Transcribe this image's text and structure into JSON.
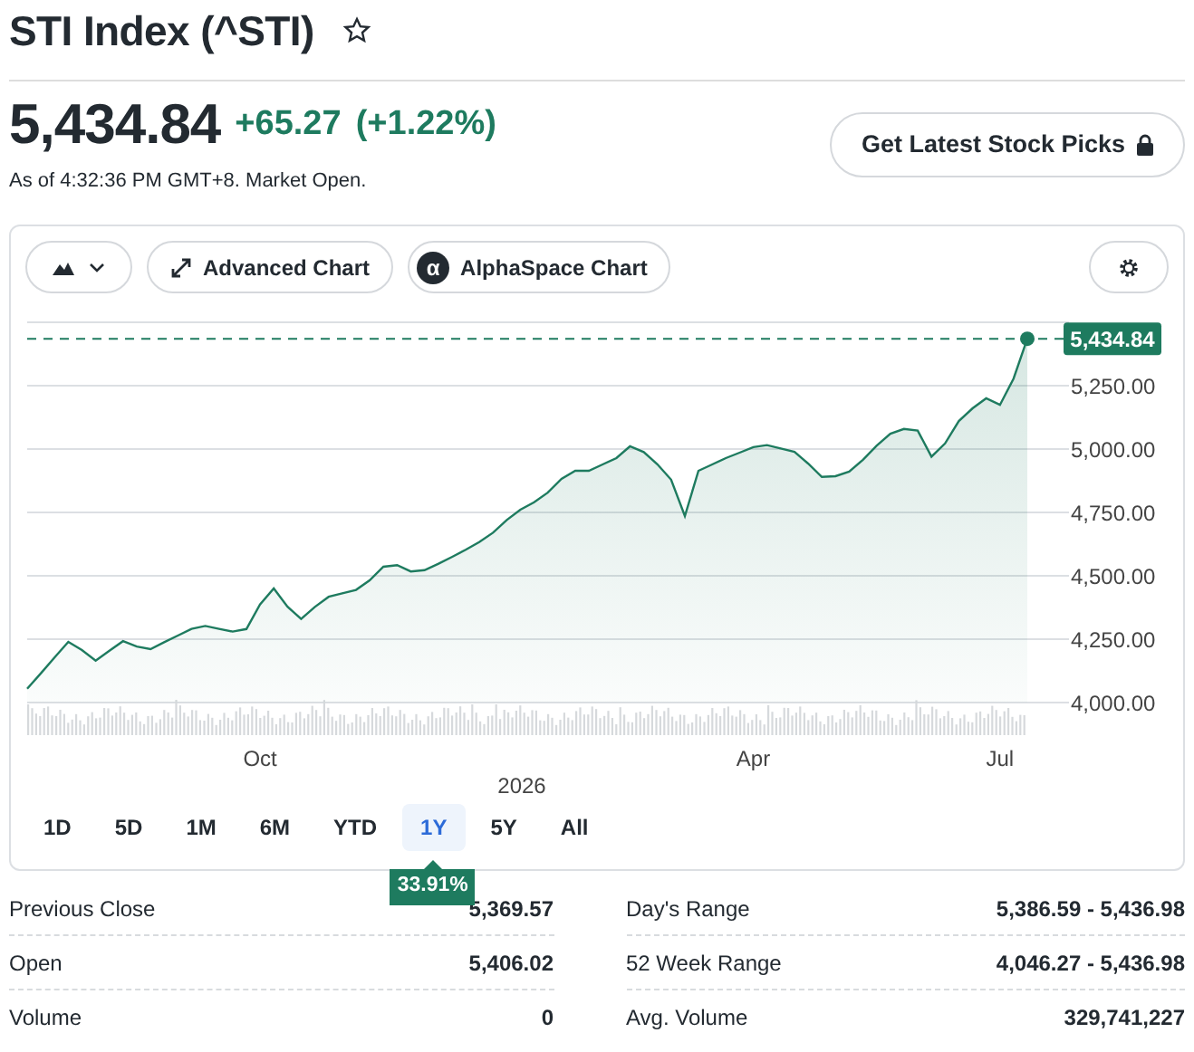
{
  "header": {
    "title": "STI Index (^STI)",
    "watchlist_starred": false
  },
  "quote": {
    "price": "5,434.84",
    "change": "+65.27",
    "change_percent": "(+1.22%)",
    "timestamp": "As of 4:32:36 PM GMT+8. Market Open.",
    "picks_button": "Get Latest Stock Picks"
  },
  "chart_toolbar": {
    "buttons": [
      {
        "kind": "type"
      },
      {
        "kind": "advanced",
        "label": "Advanced Chart"
      },
      {
        "kind": "alpha",
        "label": "AlphaSpace Chart",
        "icon_char": "α"
      }
    ]
  },
  "chart": {
    "last_price_tag": "5,434.84",
    "x_caption": "2026",
    "chart_data": {
      "type": "area",
      "categories": [
        null,
        null,
        null,
        null,
        null,
        null,
        null,
        null,
        null,
        null,
        null,
        null,
        null,
        null,
        null,
        null,
        null,
        "Oct",
        null,
        null,
        null,
        null,
        null,
        null,
        null,
        null,
        null,
        null,
        null,
        null,
        null,
        null,
        null,
        null,
        null,
        null,
        null,
        null,
        null,
        null,
        null,
        null,
        null,
        null,
        null,
        null,
        null,
        null,
        null,
        null,
        null,
        null,
        null,
        "Apr",
        null,
        null,
        null,
        null,
        null,
        null,
        null,
        null,
        null,
        null,
        null,
        null,
        null,
        null,
        null,
        null,
        null,
        "Jul",
        null,
        null
      ],
      "series": [
        {
          "color": "#1e7b5f",
          "values": [
            4054,
            4116,
            4178,
            4239,
            4207,
            4165,
            4204,
            4242,
            4221,
            4211,
            4238,
            4264,
            4291,
            4302,
            4291,
            4280,
            4290,
            4387,
            4450,
            4378,
            4330,
            4377,
            4417,
            4431,
            4444,
            4482,
            4536,
            4542,
            4517,
            4522,
            4547,
            4574,
            4603,
            4633,
            4670,
            4720,
            4761,
            4790,
            4828,
            4882,
            4914,
            4914,
            4939,
            4964,
            5011,
            4988,
            4940,
            4879,
            4736,
            4914,
            4939,
            4964,
            4986,
            5008,
            5016,
            5002,
            4989,
            4943,
            4890,
            4893,
            4911,
            4958,
            5013,
            5061,
            5079,
            5073,
            4970,
            5022,
            5111,
            5161,
            5200,
            5174,
            5278,
            5435
          ]
        }
      ],
      "ylim": [
        4000,
        5500
      ],
      "grid": true,
      "ref_lines": [
        {
          "value": 5435,
          "axis": "y"
        }
      ],
      "yticks": [
        {
          "value": 4000,
          "label": "4,000.00"
        },
        {
          "value": 4250,
          "label": "4,250.00"
        },
        {
          "value": 4500,
          "label": "4,500.00"
        },
        {
          "value": 4750,
          "label": "4,750.00"
        },
        {
          "value": 5000,
          "label": "5,000.00"
        },
        {
          "value": 5250,
          "label": "5,250.00"
        }
      ]
    }
  },
  "ranges": [
    {
      "label": "1D",
      "selected": false
    },
    {
      "label": "5D",
      "selected": false
    },
    {
      "label": "1M",
      "selected": false
    },
    {
      "label": "6M",
      "selected": false
    },
    {
      "label": "YTD",
      "selected": false
    },
    {
      "label": "1Y",
      "selected": true
    },
    {
      "label": "5Y",
      "selected": false
    },
    {
      "label": "All",
      "selected": false
    }
  ],
  "range_change_tooltip": "33.91%",
  "stats": {
    "left": [
      {
        "label": "Previous Close",
        "value": "5,369.57"
      },
      {
        "label": "Open",
        "value": "5,406.02"
      },
      {
        "label": "Volume",
        "value": "0"
      }
    ],
    "right": [
      {
        "label": "Day's Range",
        "value": "5,386.59 - 5,436.98"
      },
      {
        "label": "52 Week Range",
        "value": "4,046.27 - 5,436.98"
      },
      {
        "label": "Avg. Volume",
        "value": "329,741,227"
      }
    ]
  }
}
